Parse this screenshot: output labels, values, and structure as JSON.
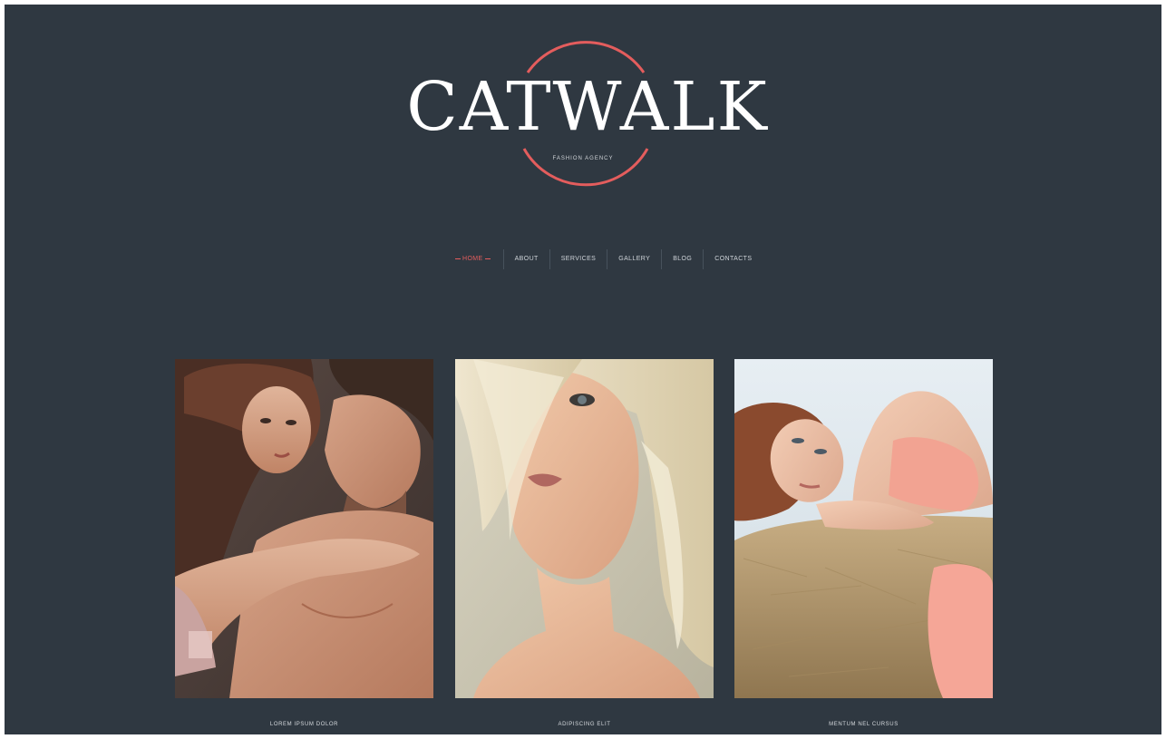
{
  "logo": {
    "title": "CATWALK",
    "tagline": "FASHION AGENCY",
    "accent_color": "#e45d5d"
  },
  "nav": {
    "items": [
      {
        "label": "HOME",
        "active": true
      },
      {
        "label": "ABOUT",
        "active": false
      },
      {
        "label": "SERVICES",
        "active": false
      },
      {
        "label": "GALLERY",
        "active": false
      },
      {
        "label": "BLOG",
        "active": false
      },
      {
        "label": "CONTACTS",
        "active": false
      }
    ]
  },
  "gallery": {
    "items": [
      {
        "caption": "LOREM IPSUM DOLOR",
        "image": "couple-embrace-photo"
      },
      {
        "caption": "ADIPISCING ELIT",
        "image": "blonde-woman-portrait-photo"
      },
      {
        "caption": "MENTUM NEL CURSUS",
        "image": "woman-on-hay-photo"
      }
    ]
  },
  "colors": {
    "background": "#2f3841",
    "text": "#ffffff",
    "accent": "#e45d5d"
  }
}
